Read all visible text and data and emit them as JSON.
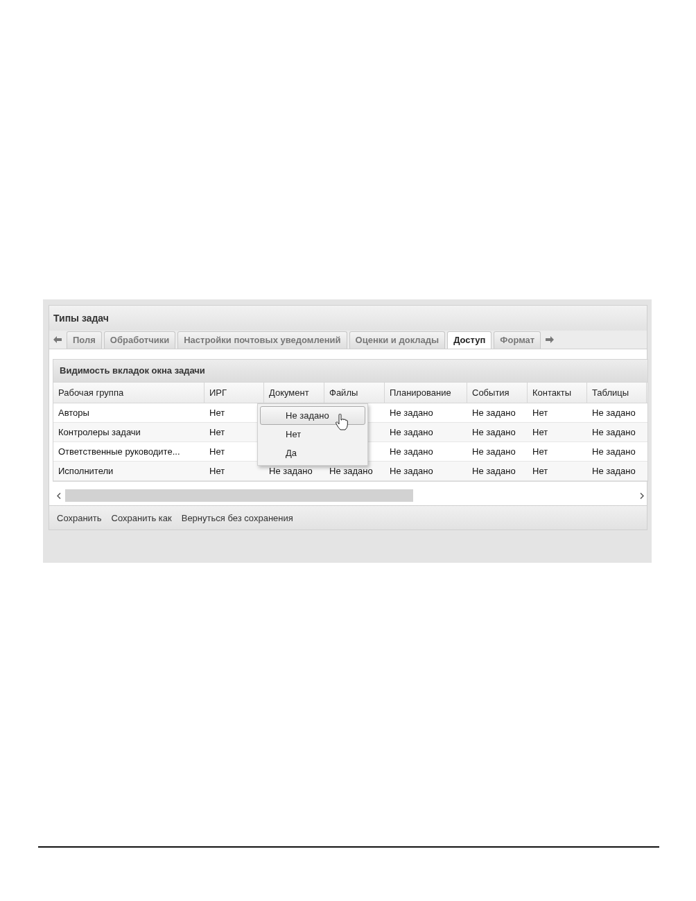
{
  "window": {
    "title": "Типы задач"
  },
  "tabs": [
    {
      "label": "Поля",
      "selected": false
    },
    {
      "label": "Обработчики",
      "selected": false
    },
    {
      "label": "Настройки почтовых уведомлений",
      "selected": false
    },
    {
      "label": "Оценки и доклады",
      "selected": false
    },
    {
      "label": "Доступ",
      "selected": true
    },
    {
      "label": "Формат",
      "selected": false
    }
  ],
  "grid": {
    "title": "Видимость вкладок окна задачи",
    "columns": [
      "Рабочая группа",
      "ИРГ",
      "Документ",
      "Файлы",
      "Планирование",
      "События",
      "Контакты",
      "Таблицы"
    ],
    "rows": [
      {
        "cells": [
          "Авторы",
          "Нет",
          null,
          null,
          "Не задано",
          "Не задано",
          "Нет",
          "Не задано"
        ]
      },
      {
        "cells": [
          "Контролеры задачи",
          "Нет",
          null,
          null,
          "Не задано",
          "Не задано",
          "Нет",
          "Не задано"
        ]
      },
      {
        "cells": [
          "Ответственные руководите...",
          "Нет",
          null,
          null,
          "Не задано",
          "Не задано",
          "Нет",
          "Не задано"
        ]
      },
      {
        "cells": [
          "Исполнители",
          "Нет",
          "Не задано",
          "Не задано",
          "Не задано",
          "Не задано",
          "Нет",
          "Не задано"
        ]
      }
    ]
  },
  "dropdown": {
    "options": [
      {
        "label": "Не задано",
        "selected": true
      },
      {
        "label": "Нет",
        "selected": false
      },
      {
        "label": "Да",
        "selected": false
      }
    ]
  },
  "toolbar": {
    "buttons": [
      "Сохранить",
      "Сохранить как",
      "Вернуться без сохранения"
    ]
  }
}
